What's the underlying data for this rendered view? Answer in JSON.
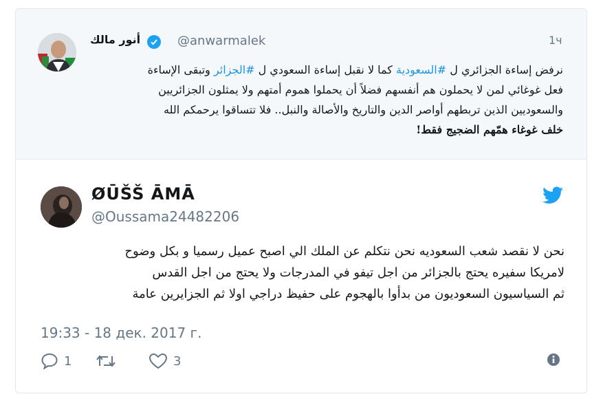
{
  "quoted": {
    "name": "أنور مالك",
    "handle": "@anwarmalek",
    "time": "1ч",
    "lines": [
      [
        "نرفض إساءة الجزائري ل ",
        "#السعودية",
        " كما لا نقبل إساءة السعودي ل ",
        "#الجزائر",
        " وتبقى الإساءة"
      ],
      "فعل غوغائي لمن لا يحملون هم أنفسهم فضلاً أن يحملوا هموم أمتهم ولا يمثلون الجزائريين",
      "والسعوديين الذين تربطهم أواصر الدين والتاريخ والأصالة والنبل.. فلا تتساقوا يرحمكم الله",
      "خلف غوغاء همّهم الضجيج فقط!"
    ]
  },
  "tweet": {
    "name": "ØŪŠŠ ĀMĀ",
    "handle": "@Oussama24482206",
    "lines": [
      "نحن لا نقصد شعب السعوديه نحن نتكلم عن الملك الي اصبح عميل رسميا و بكل وضوح",
      "لامريكا سفيره يحتج بالجزائر من اجل تيفو في المدرجات ولا يحتج من اجل القدس",
      "ثم السياسيون السعوديون من بدأوا بالهجوم على حفيظ دراجي اولا ثم الجزايرين عامة"
    ],
    "date": "19:33 - 18 дек. 2017 г.",
    "reply_count": "1",
    "retweet_count": "",
    "like_count": "3"
  },
  "icons": {
    "verified": "verified-badge-icon",
    "bird": "twitter-bird-icon",
    "reply": "reply-icon",
    "retweet": "retweet-icon",
    "like": "heart-icon",
    "info": "info-icon"
  },
  "colors": {
    "accent": "#1da1f2",
    "hashtag": "#1b95e0",
    "muted": "#657786",
    "quoted_bg": "#f5f8fa"
  }
}
